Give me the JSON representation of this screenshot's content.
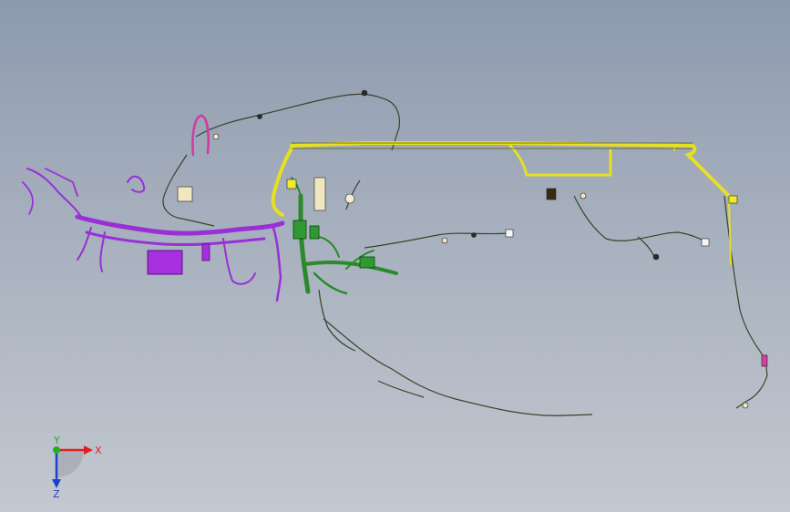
{
  "triad": {
    "x_label": "X",
    "y_label": "Y",
    "z_label": "Z",
    "colors": {
      "x": "#e02020",
      "y": "#20b020",
      "z": "#2040d0"
    }
  },
  "colors": {
    "background_top": "#8d9aae",
    "background_bottom": "#c3c8d0",
    "purple_harness": "#9b30d8",
    "green_harness": "#2a8a2a",
    "yellow_harness": "#e8e020",
    "thin_wire": "#3a4a2a",
    "magenta_accent": "#d040a0"
  }
}
